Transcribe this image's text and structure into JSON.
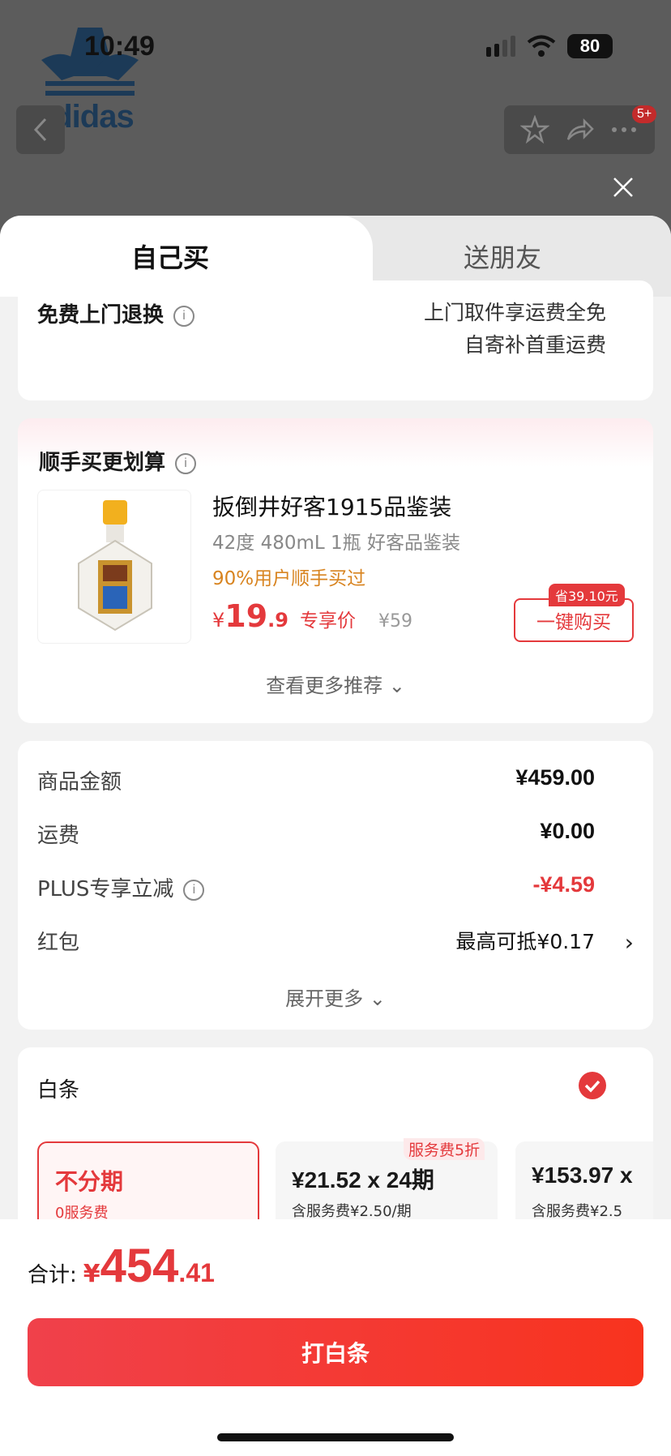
{
  "status": {
    "time": "10:49",
    "battery": "80"
  },
  "background": {
    "brand": "adidas",
    "badge": "5+"
  },
  "tabs": {
    "self": "自己买",
    "friend": "送朋友"
  },
  "returns": {
    "label": "免费上门退换",
    "line1": "上门取件享运费全免",
    "line2": "自寄补首重运费"
  },
  "addon": {
    "title": "顺手买更划算",
    "name": "扳倒井好客1915品鉴装",
    "spec": "42度 480mL 1瓶 好客品鉴装",
    "users": "90%用户顺手买过",
    "currency": "¥",
    "price_int": "19",
    "price_dec": ".9",
    "price_tag": "专享价",
    "orig": "¥59",
    "save": "省39.10元",
    "buy": "一键购买",
    "more": "查看更多推荐"
  },
  "summary": {
    "rows": [
      {
        "label": "商品金额",
        "value": "¥459.00"
      },
      {
        "label": "运费",
        "value": "¥0.00"
      },
      {
        "label": "PLUS专享立减",
        "value": "-¥4.59"
      },
      {
        "label": "红包",
        "value": "最高可抵¥0.17"
      }
    ],
    "expand": "展开更多"
  },
  "baitiao": {
    "title": "白条",
    "opt1": {
      "title": "不分期",
      "sub": "0服务费"
    },
    "opt2": {
      "title": "¥21.52 x 24期",
      "sub": "含服务费¥2.50/期"
    },
    "opt3": {
      "title": "¥153.97 x",
      "sub": "含服务费¥2.5"
    },
    "discount": "服务费5折"
  },
  "footer": {
    "label": "合计:",
    "currency": "¥",
    "int": "454",
    "dec": ".41",
    "pay": "打白条"
  },
  "colors": {
    "accent": "#e4393c",
    "gold": "#d88420"
  }
}
